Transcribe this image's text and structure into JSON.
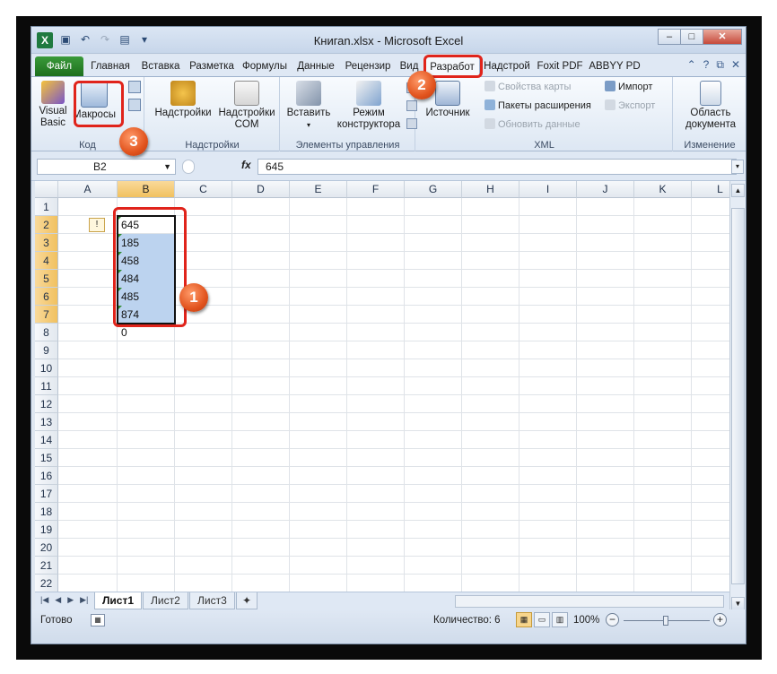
{
  "window": {
    "title": "Книганn.xlsx - Microsoft Excel",
    "logo": "X",
    "min": "–",
    "max": "□",
    "close": "✕"
  },
  "qat": [
    "save-icon",
    "undo-icon",
    "redo-icon",
    "dropdown-icon"
  ],
  "tabs": [
    {
      "label": "Файл",
      "name": "file"
    },
    {
      "label": "Главная",
      "name": "home"
    },
    {
      "label": "Вставка",
      "name": "insert"
    },
    {
      "label": "Разметка",
      "name": "layout"
    },
    {
      "label": "Формулы",
      "name": "formulas"
    },
    {
      "label": "Данные",
      "name": "data"
    },
    {
      "label": "Рецензир",
      "name": "review"
    },
    {
      "label": "Вид",
      "name": "view"
    },
    {
      "label": "Разработ",
      "name": "developer"
    },
    {
      "label": "Надстрой",
      "name": "addins"
    },
    {
      "label": "Foxit PDF",
      "name": "foxit"
    },
    {
      "label": "ABBYY PD",
      "name": "abbyy"
    }
  ],
  "ribbon": {
    "code": {
      "label": "Код",
      "visual_basic": "Visual Basic",
      "macros": "Макросы"
    },
    "addins": {
      "label": "Надстройки",
      "addins_btn": "Надстройки",
      "com_btn": "Надстройки COM"
    },
    "controls": {
      "label": "Элементы управления",
      "insert": "Вставить",
      "design_mode": "Режим конструктора"
    },
    "xml": {
      "label": "XML",
      "source": "Источник",
      "map_props": "Свойства карты",
      "ext_packs": "Пакеты расширения",
      "refresh": "Обновить данные",
      "import": "Импорт",
      "export": "Экспорт"
    },
    "modify": {
      "label": "Изменение",
      "doc_panel": "Область документа"
    }
  },
  "formula_bar": {
    "name_box": "B2",
    "fx": "fx",
    "value": "645"
  },
  "columns": [
    "A",
    "B",
    "C",
    "D",
    "E",
    "F",
    "G",
    "H",
    "I",
    "J",
    "K",
    "L"
  ],
  "rows": [
    "1",
    "2",
    "3",
    "4",
    "5",
    "6",
    "7",
    "8",
    "9",
    "10",
    "11",
    "12",
    "13",
    "14",
    "15",
    "16",
    "17",
    "18",
    "19",
    "20",
    "21",
    "22"
  ],
  "cells": {
    "B2": "645",
    "B3": "185",
    "B4": "458",
    "B5": "484",
    "B6": "485",
    "B7": "874",
    "B8": "0"
  },
  "sheets": [
    "Лист1",
    "Лист2",
    "Лист3"
  ],
  "status": {
    "ready": "Готово",
    "count": "Количество: 6",
    "zoom": "100%"
  },
  "annotations": [
    "1",
    "2",
    "3"
  ],
  "colors": {
    "highlight": "#e0241b",
    "selection": "#bcd3ef",
    "file_tab": "#2a862a"
  }
}
